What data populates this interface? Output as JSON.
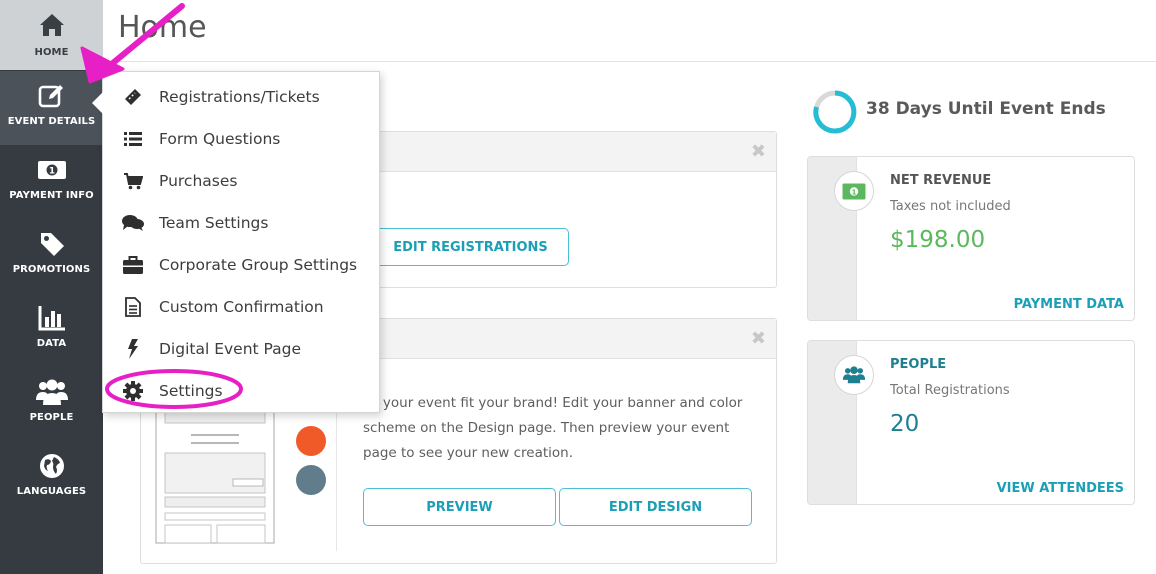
{
  "sidebar": {
    "items": [
      {
        "label": "HOME",
        "icon": "home-icon"
      },
      {
        "label": "EVENT DETAILS",
        "icon": "edit-icon"
      },
      {
        "label": "PAYMENT INFO",
        "icon": "money-icon"
      },
      {
        "label": "PROMOTIONS",
        "icon": "tag-icon"
      },
      {
        "label": "DATA",
        "icon": "bar-chart-icon"
      },
      {
        "label": "PEOPLE",
        "icon": "people-icon"
      },
      {
        "label": "LANGUAGES",
        "icon": "globe-icon"
      }
    ]
  },
  "header": {
    "title": "Home"
  },
  "menu": {
    "items": [
      {
        "label": "Registrations/Tickets",
        "icon": "ticket-icon"
      },
      {
        "label": "Form Questions",
        "icon": "list-icon"
      },
      {
        "label": "Purchases",
        "icon": "cart-icon"
      },
      {
        "label": "Team Settings",
        "icon": "chat-icon"
      },
      {
        "label": "Corporate Group Settings",
        "icon": "briefcase-icon"
      },
      {
        "label": "Custom Confirmation",
        "icon": "document-icon"
      },
      {
        "label": "Digital Event Page",
        "icon": "lightning-icon"
      },
      {
        "label": "Settings",
        "icon": "gear-icon"
      }
    ]
  },
  "cards": {
    "registrations": {
      "button": "EDIT REGISTRATIONS"
    },
    "design": {
      "text": "ke your event fit your brand! Edit your banner and color scheme on the Design page. Then preview your event page to see your new creation.",
      "preview_button": "PREVIEW",
      "edit_button": "EDIT DESIGN"
    }
  },
  "countdown": {
    "text": "38 Days Until Event Ends"
  },
  "stats": {
    "revenue": {
      "title": "NET REVENUE",
      "subtitle": "Taxes not included",
      "value": "$198.00",
      "link": "PAYMENT DATA",
      "icon": "money-icon"
    },
    "people": {
      "title": "PEOPLE",
      "subtitle": "Total Registrations",
      "value": "20",
      "link": "VIEW ATTENDEES",
      "icon": "people-icon"
    }
  },
  "colors": {
    "sidebar": "#353b41",
    "accent": "#1b9fb6",
    "revenue_green": "#5cb85c",
    "people_teal": "#1e7f91",
    "annotation": "#e620c6"
  }
}
